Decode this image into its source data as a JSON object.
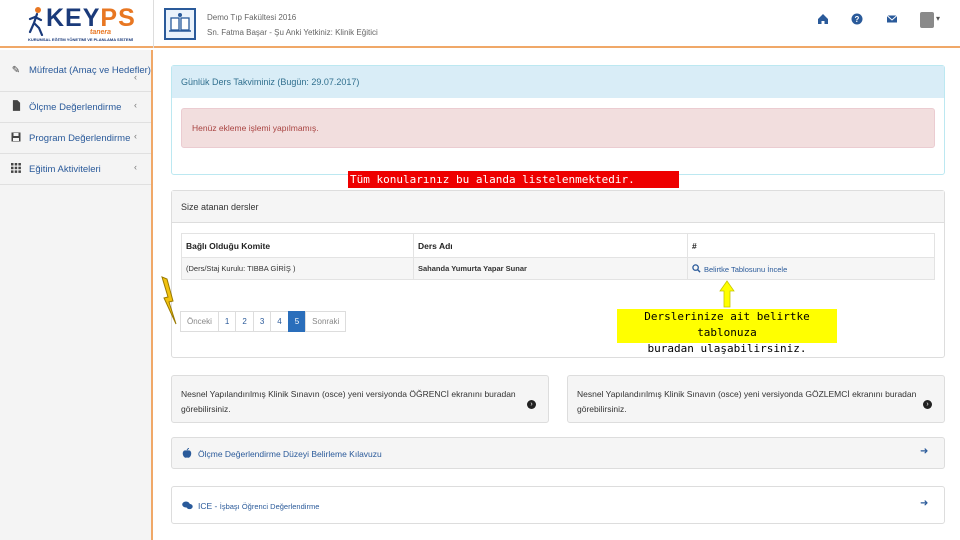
{
  "header": {
    "logo": {
      "main": "KEYPS",
      "sub_italic": "tanera",
      "sub_small": "KURUMSAL EĞİTİM YÖNETİMİ VE PLANLAMA SİSTEMİ"
    },
    "faculty": "Demo Tıp Fakültesi 2016",
    "user": "Sn. Fatma Başar - Şu Anki Yetkiniz: Klinik Eğitici",
    "icons": [
      "home-icon",
      "question-icon",
      "envelope-icon",
      "user-avatar-icon"
    ]
  },
  "sidebar": {
    "items": [
      {
        "label": "Müfredat (Amaç ve Hedefler)",
        "icon": "pencil-icon"
      },
      {
        "label": "Ölçme Değerlendirme",
        "icon": "file-icon"
      },
      {
        "label": "Program Değerlendirme",
        "icon": "floppy-icon"
      },
      {
        "label": "Eğitim Aktiviteleri",
        "icon": "grid-icon"
      }
    ]
  },
  "calendar": {
    "title": "Günlük Ders Takviminiz (Bugün: 29.07.2017)",
    "alert": "Henüz ekleme işlemi yapılmamış."
  },
  "annotations": {
    "red": "Tüm konularınız bu alanda listelenmektedir.",
    "yellow_line1": "Derslerinize ait belirtke tablonuza",
    "yellow_line2": "buradan ulaşabilirsiniz."
  },
  "courses": {
    "title": "Size atanan dersler",
    "columns": [
      "Bağlı Olduğu Komite",
      "Ders Adı",
      "#"
    ],
    "rows": [
      {
        "committee": "(Ders/Staj Kurulu: TIBBA GİRİŞ )",
        "course": "Sahanda Yumurta Yapar Sunar",
        "action": "Belirtke Tablosunu İncele"
      }
    ],
    "pagination": {
      "prev": "Önceki",
      "pages": [
        "1",
        "2",
        "3",
        "4",
        "5"
      ],
      "active": "5",
      "next": "Sonraki"
    }
  },
  "osce": {
    "student": "Nesnel Yapılandırılmış Klinik Sınavın (osce) yeni versiyonda ÖĞRENCİ ekranını buradan görebilirsiniz.",
    "observer": "Nesnel Yapılandırılmış Klinik Sınavın (osce) yeni versiyonda GÖZLEMCİ ekranını buradan görebilirsiniz."
  },
  "guides": {
    "measurement": "Ölçme Değerlendirme Düzeyi Belirleme Kılavuzu",
    "ice_prefix": "ICE - ",
    "ice_rest": "İşbaşı Öğrenci Değerlendirme"
  },
  "colors": {
    "accent_orange": "#f0a868",
    "brand_blue": "#2a5a9a",
    "alert_red_bg": "#f2dede",
    "annotation_red": "#ee0000",
    "annotation_yellow": "#ffff00"
  }
}
